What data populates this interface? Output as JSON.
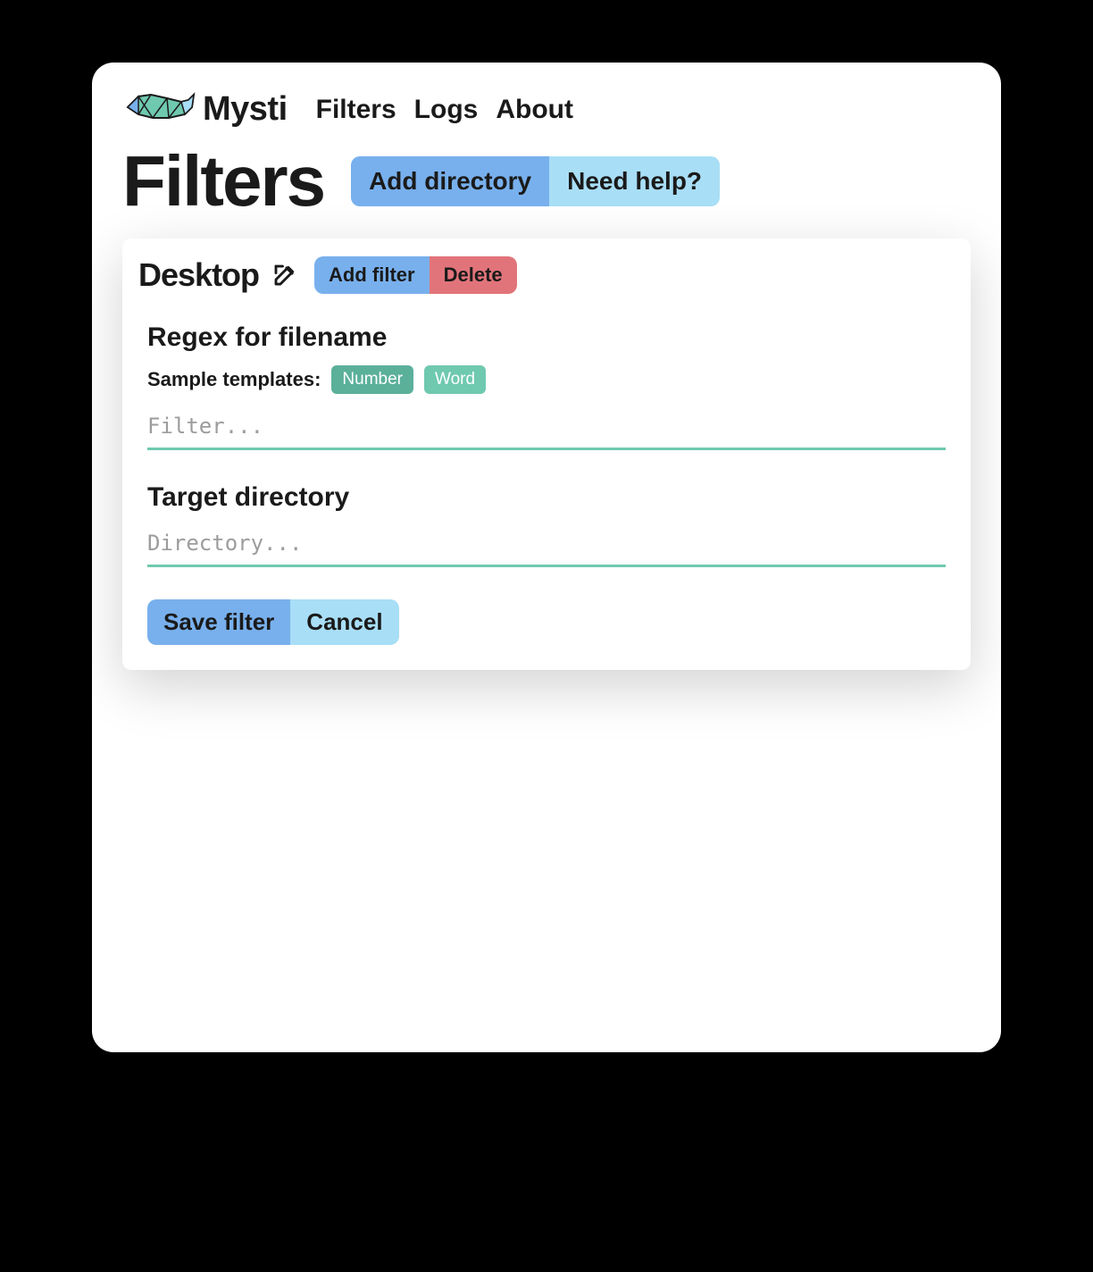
{
  "brand": {
    "name": "Mysti"
  },
  "nav": {
    "items": [
      {
        "label": "Filters"
      },
      {
        "label": "Logs"
      },
      {
        "label": "About"
      }
    ]
  },
  "page": {
    "title": "Filters",
    "add_directory_label": "Add directory",
    "need_help_label": "Need help?"
  },
  "card": {
    "directory_name": "Desktop",
    "add_filter_label": "Add filter",
    "delete_label": "Delete"
  },
  "regex_section": {
    "title": "Regex for filename",
    "templates_label": "Sample templates:",
    "templates": [
      {
        "label": "Number"
      },
      {
        "label": "Word"
      }
    ],
    "input_value": "",
    "input_placeholder": "Filter..."
  },
  "target_section": {
    "title": "Target directory",
    "input_value": "",
    "input_placeholder": "Directory..."
  },
  "actions": {
    "save_label": "Save filter",
    "cancel_label": "Cancel"
  },
  "colors": {
    "blue": "#78b0ed",
    "lightblue": "#a8def6",
    "red": "#e1747a",
    "green": "#6fc9af",
    "green_dark": "#5bb09a"
  }
}
